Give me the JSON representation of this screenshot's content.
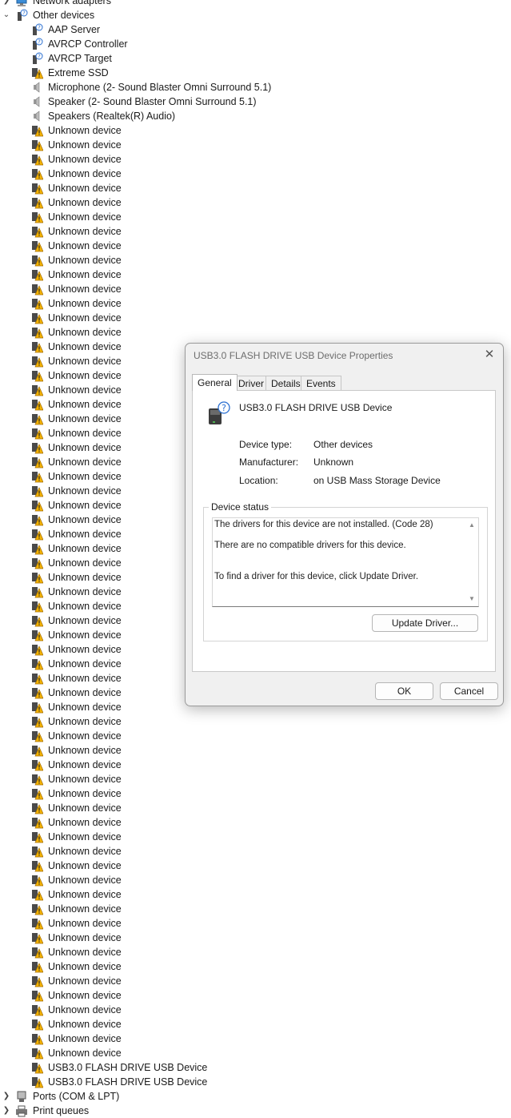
{
  "tree": {
    "categories": {
      "network": "Network adapters",
      "other": "Other devices",
      "ports": "Ports (COM & LPT)",
      "print": "Print queues"
    },
    "other_items": [
      {
        "label": "AAP Server",
        "icon": "bluetooth-unknown-icon"
      },
      {
        "label": "AVRCP Controller",
        "icon": "bluetooth-unknown-icon"
      },
      {
        "label": "AVRCP Target",
        "icon": "bluetooth-unknown-icon"
      },
      {
        "label": "Extreme SSD",
        "icon": "warning-device-icon"
      },
      {
        "label": "Microphone (2- Sound Blaster Omni Surround 5.1)",
        "icon": "speaker-icon"
      },
      {
        "label": "Speaker (2- Sound Blaster Omni Surround 5.1)",
        "icon": "speaker-icon"
      },
      {
        "label": "Speakers (Realtek(R) Audio)",
        "icon": "speaker-icon"
      },
      {
        "label": "Unknown device",
        "icon": "warning-device-icon"
      },
      {
        "label": "Unknown device",
        "icon": "warning-device-icon"
      },
      {
        "label": "Unknown device",
        "icon": "warning-device-icon"
      },
      {
        "label": "Unknown device",
        "icon": "warning-device-icon"
      },
      {
        "label": "Unknown device",
        "icon": "warning-device-icon"
      },
      {
        "label": "Unknown device",
        "icon": "warning-device-icon"
      },
      {
        "label": "Unknown device",
        "icon": "warning-device-icon"
      },
      {
        "label": "Unknown device",
        "icon": "warning-device-icon"
      },
      {
        "label": "Unknown device",
        "icon": "warning-device-icon"
      },
      {
        "label": "Unknown device",
        "icon": "warning-device-icon"
      },
      {
        "label": "Unknown device",
        "icon": "warning-device-icon"
      },
      {
        "label": "Unknown device",
        "icon": "warning-device-icon"
      },
      {
        "label": "Unknown device",
        "icon": "warning-device-icon"
      },
      {
        "label": "Unknown device",
        "icon": "warning-device-icon"
      },
      {
        "label": "Unknown device",
        "icon": "warning-device-icon"
      },
      {
        "label": "Unknown device",
        "icon": "warning-device-icon"
      },
      {
        "label": "Unknown device",
        "icon": "warning-device-icon"
      },
      {
        "label": "Unknown device",
        "icon": "warning-device-icon"
      },
      {
        "label": "Unknown device",
        "icon": "warning-device-icon"
      },
      {
        "label": "Unknown device",
        "icon": "warning-device-icon"
      },
      {
        "label": "Unknown device",
        "icon": "warning-device-icon"
      },
      {
        "label": "Unknown device",
        "icon": "warning-device-icon"
      },
      {
        "label": "Unknown device",
        "icon": "warning-device-icon"
      },
      {
        "label": "Unknown device",
        "icon": "warning-device-icon"
      },
      {
        "label": "Unknown device",
        "icon": "warning-device-icon"
      },
      {
        "label": "Unknown device",
        "icon": "warning-device-icon"
      },
      {
        "label": "Unknown device",
        "icon": "warning-device-icon"
      },
      {
        "label": "Unknown device",
        "icon": "warning-device-icon"
      },
      {
        "label": "Unknown device",
        "icon": "warning-device-icon"
      },
      {
        "label": "Unknown device",
        "icon": "warning-device-icon"
      },
      {
        "label": "Unknown device",
        "icon": "warning-device-icon"
      },
      {
        "label": "Unknown device",
        "icon": "warning-device-icon"
      },
      {
        "label": "Unknown device",
        "icon": "warning-device-icon"
      },
      {
        "label": "Unknown device",
        "icon": "warning-device-icon"
      },
      {
        "label": "Unknown device",
        "icon": "warning-device-icon"
      },
      {
        "label": "Unknown device",
        "icon": "warning-device-icon"
      },
      {
        "label": "Unknown device",
        "icon": "warning-device-icon"
      },
      {
        "label": "Unknown device",
        "icon": "warning-device-icon"
      },
      {
        "label": "Unknown device",
        "icon": "warning-device-icon"
      },
      {
        "label": "Unknown device",
        "icon": "warning-device-icon"
      },
      {
        "label": "Unknown device",
        "icon": "warning-device-icon"
      },
      {
        "label": "Unknown device",
        "icon": "warning-device-icon"
      },
      {
        "label": "Unknown device",
        "icon": "warning-device-icon"
      },
      {
        "label": "Unknown device",
        "icon": "warning-device-icon"
      },
      {
        "label": "Unknown device",
        "icon": "warning-device-icon"
      },
      {
        "label": "Unknown device",
        "icon": "warning-device-icon"
      },
      {
        "label": "Unknown device",
        "icon": "warning-device-icon"
      },
      {
        "label": "Unknown device",
        "icon": "warning-device-icon"
      },
      {
        "label": "Unknown device",
        "icon": "warning-device-icon"
      },
      {
        "label": "Unknown device",
        "icon": "warning-device-icon"
      },
      {
        "label": "Unknown device",
        "icon": "warning-device-icon"
      },
      {
        "label": "Unknown device",
        "icon": "warning-device-icon"
      },
      {
        "label": "Unknown device",
        "icon": "warning-device-icon"
      },
      {
        "label": "Unknown device",
        "icon": "warning-device-icon"
      },
      {
        "label": "Unknown device",
        "icon": "warning-device-icon"
      },
      {
        "label": "Unknown device",
        "icon": "warning-device-icon"
      },
      {
        "label": "Unknown device",
        "icon": "warning-device-icon"
      },
      {
        "label": "Unknown device",
        "icon": "warning-device-icon"
      },
      {
        "label": "Unknown device",
        "icon": "warning-device-icon"
      },
      {
        "label": "Unknown device",
        "icon": "warning-device-icon"
      },
      {
        "label": "Unknown device",
        "icon": "warning-device-icon"
      },
      {
        "label": "Unknown device",
        "icon": "warning-device-icon"
      },
      {
        "label": "Unknown device",
        "icon": "warning-device-icon"
      },
      {
        "label": "Unknown device",
        "icon": "warning-device-icon"
      },
      {
        "label": "Unknown device",
        "icon": "warning-device-icon"
      },
      {
        "label": "USB3.0 FLASH DRIVE USB Device",
        "icon": "warning-device-icon"
      },
      {
        "label": "USB3.0 FLASH DRIVE USB Device",
        "icon": "warning-device-icon"
      }
    ]
  },
  "dialog": {
    "title": "USB3.0 FLASH DRIVE USB Device Properties",
    "tabs": [
      "General",
      "Driver",
      "Details",
      "Events"
    ],
    "device_name": "USB3.0 FLASH DRIVE USB Device",
    "props": {
      "type_label": "Device type:",
      "type_value": "Other devices",
      "manufacturer_label": "Manufacturer:",
      "manufacturer_value": "Unknown",
      "location_label": "Location:",
      "location_value": "on USB Mass Storage Device"
    },
    "status_label": "Device status",
    "status_lines": [
      "The drivers for this device are not installed. (Code 28)",
      "There are no compatible drivers for this device.",
      "To find a driver for this device, click Update Driver."
    ],
    "update_button": "Update Driver...",
    "ok_button": "OK",
    "cancel_button": "Cancel"
  }
}
